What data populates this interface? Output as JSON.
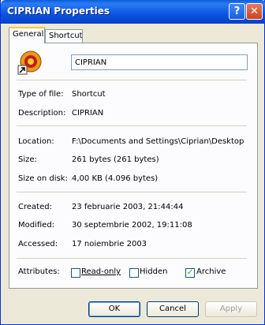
{
  "window": {
    "title": "CIPRIAN Properties",
    "help_glyph": "?",
    "close_glyph": "✕"
  },
  "tabs": [
    "General",
    "Shortcut"
  ],
  "general": {
    "name_value": "CIPRIAN",
    "rows": [
      {
        "label": "Type of file:",
        "value": "Shortcut"
      },
      {
        "label": "Description:",
        "value": "CIPRIAN"
      },
      {
        "label": "Location:",
        "value": "F:\\Documents and Settings\\Ciprian\\Desktop"
      },
      {
        "label": "Size:",
        "value": "261 bytes (261 bytes)"
      },
      {
        "label": "Size on disk:",
        "value": "4,00 KB (4.096 bytes)"
      },
      {
        "label": "Created:",
        "value": "23 februarie 2003, 21:44:44"
      },
      {
        "label": "Modified:",
        "value": "30 septembrie 2002, 19:11:08"
      },
      {
        "label": "Accessed:",
        "value": "17 noiembrie 2003"
      }
    ],
    "attributes_label": "Attributes:",
    "attributes": [
      {
        "label": "Read-only",
        "checked": false
      },
      {
        "label": "Hidden",
        "checked": false
      },
      {
        "label": "Archive",
        "checked": true,
        "mark": "✓"
      }
    ]
  },
  "buttons": {
    "ok": "OK",
    "cancel": "Cancel",
    "apply": "Apply"
  },
  "icons": {
    "app": "ciprian-app-icon",
    "shortcut_overlay": "shortcut-arrow-icon",
    "help": "help-icon",
    "close": "close-icon"
  }
}
